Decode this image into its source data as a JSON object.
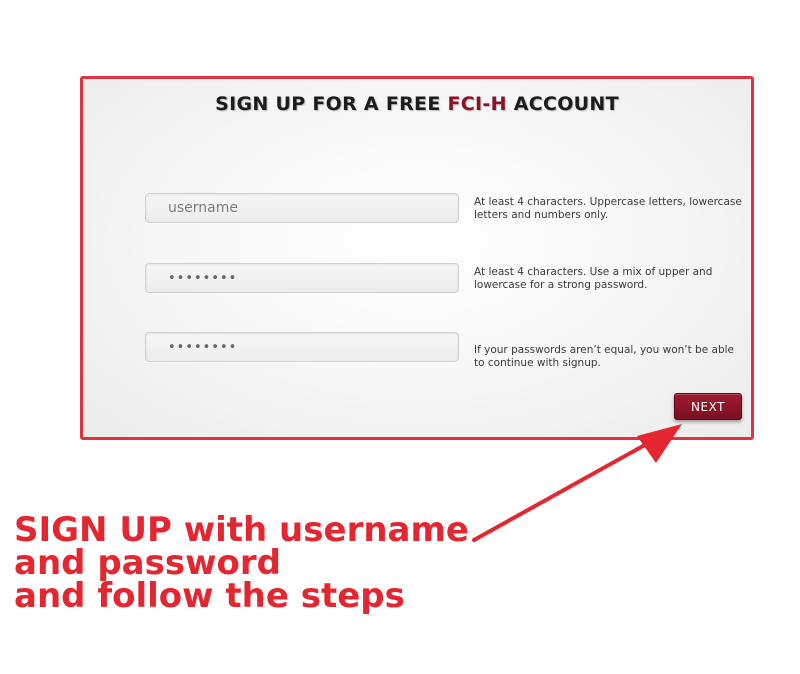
{
  "form": {
    "title_prefix": "SIGN UP FOR A FREE ",
    "title_brand": "FCI-H",
    "title_suffix": " ACCOUNT",
    "username": {
      "placeholder": "username",
      "value": "",
      "hint": "At least 4 characters. Uppercase letters, lowercase letters and numbers only."
    },
    "password": {
      "value": "••••••••",
      "hint": "At least 4 characters. Use a mix of upper and lowercase for a strong password."
    },
    "password_confirm": {
      "value": "••••••••",
      "hint": "If your passwords aren’t equal, you won’t be able to continue with signup."
    },
    "next_label": "NEXT"
  },
  "annotation": {
    "line1": "SIGN UP with username",
    "line2": "and password",
    "line3": "and follow the steps"
  },
  "colors": {
    "panel_border": "#e0333d",
    "brand": "#8a1223",
    "button": "#8b1428",
    "annotation": "#e3262f"
  }
}
